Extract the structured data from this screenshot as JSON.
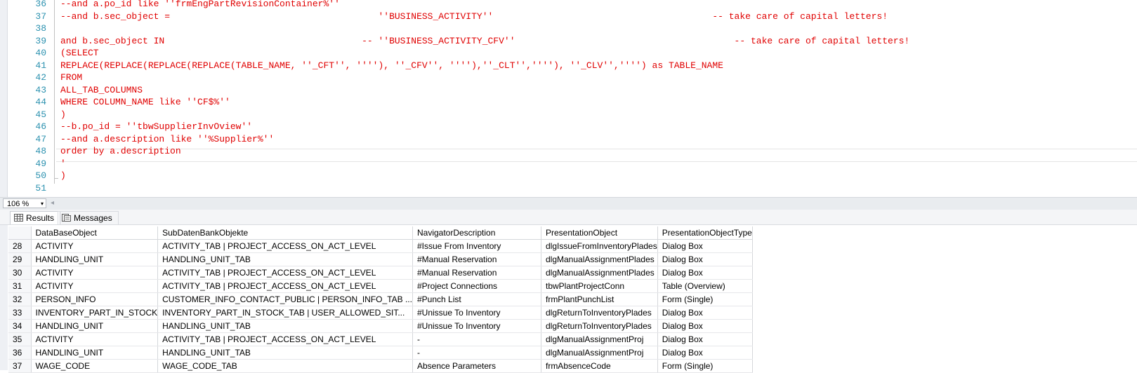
{
  "editor": {
    "lines": [
      {
        "num": "36",
        "text": "--and a.po_id like ''frmEngPartRevisionContainer%''"
      },
      {
        "num": "37",
        "text": "--and b.sec_object =                                      ''BUSINESS_ACTIVITY''                                        -- take care of capital letters!"
      },
      {
        "num": "38",
        "text": ""
      },
      {
        "num": "39",
        "text": "and b.sec_object IN                                    -- ''BUSINESS_ACTIVITY_CFV''                                        -- take care of capital letters!"
      },
      {
        "num": "40",
        "text": "(SELECT"
      },
      {
        "num": "41",
        "text": "REPLACE(REPLACE(REPLACE(REPLACE(TABLE_NAME, ''_CFT'', ''''), ''_CFV'', ''''),''_CLT'',''''), ''_CLV'','''') as TABLE_NAME"
      },
      {
        "num": "42",
        "text": "FROM"
      },
      {
        "num": "43",
        "text": "ALL_TAB_COLUMNS"
      },
      {
        "num": "44",
        "text": "WHERE COLUMN_NAME like ''CF$%''"
      },
      {
        "num": "45",
        "text": ")"
      },
      {
        "num": "46",
        "text": "--b.po_id = ''tbwSupplierInvOview''"
      },
      {
        "num": "47",
        "text": "--and a.description like ''%Supplier%''"
      },
      {
        "num": "48",
        "text": "order by a.description"
      },
      {
        "num": "49",
        "text": "'"
      },
      {
        "num": "50",
        "text": ")"
      },
      {
        "num": "51",
        "text": ""
      }
    ]
  },
  "status": {
    "zoom": "106 %",
    "zoom_arrow": "▾",
    "scroll_left": "◂"
  },
  "results_tabs": {
    "results_label": "Results",
    "messages_label": "Messages"
  },
  "grid": {
    "columns": [
      "DataBaseObject",
      "SubDatenBankObjekte",
      "NavigatorDescription",
      "PresentationObject",
      "PresentationObjectType"
    ],
    "rows": [
      {
        "n": "28",
        "cells": [
          "ACTIVITY",
          "ACTIVITY_TAB | PROJECT_ACCESS_ON_ACT_LEVEL",
          "#Issue From Inventory",
          "dlgIssueFromInventoryPlades",
          "Dialog Box"
        ]
      },
      {
        "n": "29",
        "cells": [
          "HANDLING_UNIT",
          "HANDLING_UNIT_TAB",
          "#Manual Reservation",
          "dlgManualAssignmentPlades",
          "Dialog Box"
        ]
      },
      {
        "n": "30",
        "cells": [
          "ACTIVITY",
          "ACTIVITY_TAB | PROJECT_ACCESS_ON_ACT_LEVEL",
          "#Manual Reservation",
          "dlgManualAssignmentPlades",
          "Dialog Box"
        ]
      },
      {
        "n": "31",
        "cells": [
          "ACTIVITY",
          "ACTIVITY_TAB | PROJECT_ACCESS_ON_ACT_LEVEL",
          "#Project Connections",
          "tbwPlantProjectConn",
          "Table (Overview)"
        ]
      },
      {
        "n": "32",
        "cells": [
          "PERSON_INFO",
          "CUSTOMER_INFO_CONTACT_PUBLIC | PERSON_INFO_TAB ...",
          "#Punch List",
          "frmPlantPunchList",
          "Form (Single)"
        ]
      },
      {
        "n": "33",
        "cells": [
          "INVENTORY_PART_IN_STOCK",
          "INVENTORY_PART_IN_STOCK_TAB | USER_ALLOWED_SIT...",
          "#Unissue To Inventory",
          "dlgReturnToInventoryPlades",
          "Dialog Box"
        ]
      },
      {
        "n": "34",
        "cells": [
          "HANDLING_UNIT",
          "HANDLING_UNIT_TAB",
          "#Unissue To Inventory",
          "dlgReturnToInventoryPlades",
          "Dialog Box"
        ]
      },
      {
        "n": "35",
        "cells": [
          "ACTIVITY",
          "ACTIVITY_TAB | PROJECT_ACCESS_ON_ACT_LEVEL",
          "-",
          "dlgManualAssignmentProj",
          "Dialog Box"
        ]
      },
      {
        "n": "36",
        "cells": [
          "HANDLING_UNIT",
          "HANDLING_UNIT_TAB",
          "-",
          "dlgManualAssignmentProj",
          "Dialog Box"
        ]
      },
      {
        "n": "37",
        "cells": [
          "WAGE_CODE",
          "WAGE_CODE_TAB",
          "Absence Parameters",
          "frmAbsenceCode",
          "Form (Single)"
        ]
      }
    ]
  }
}
